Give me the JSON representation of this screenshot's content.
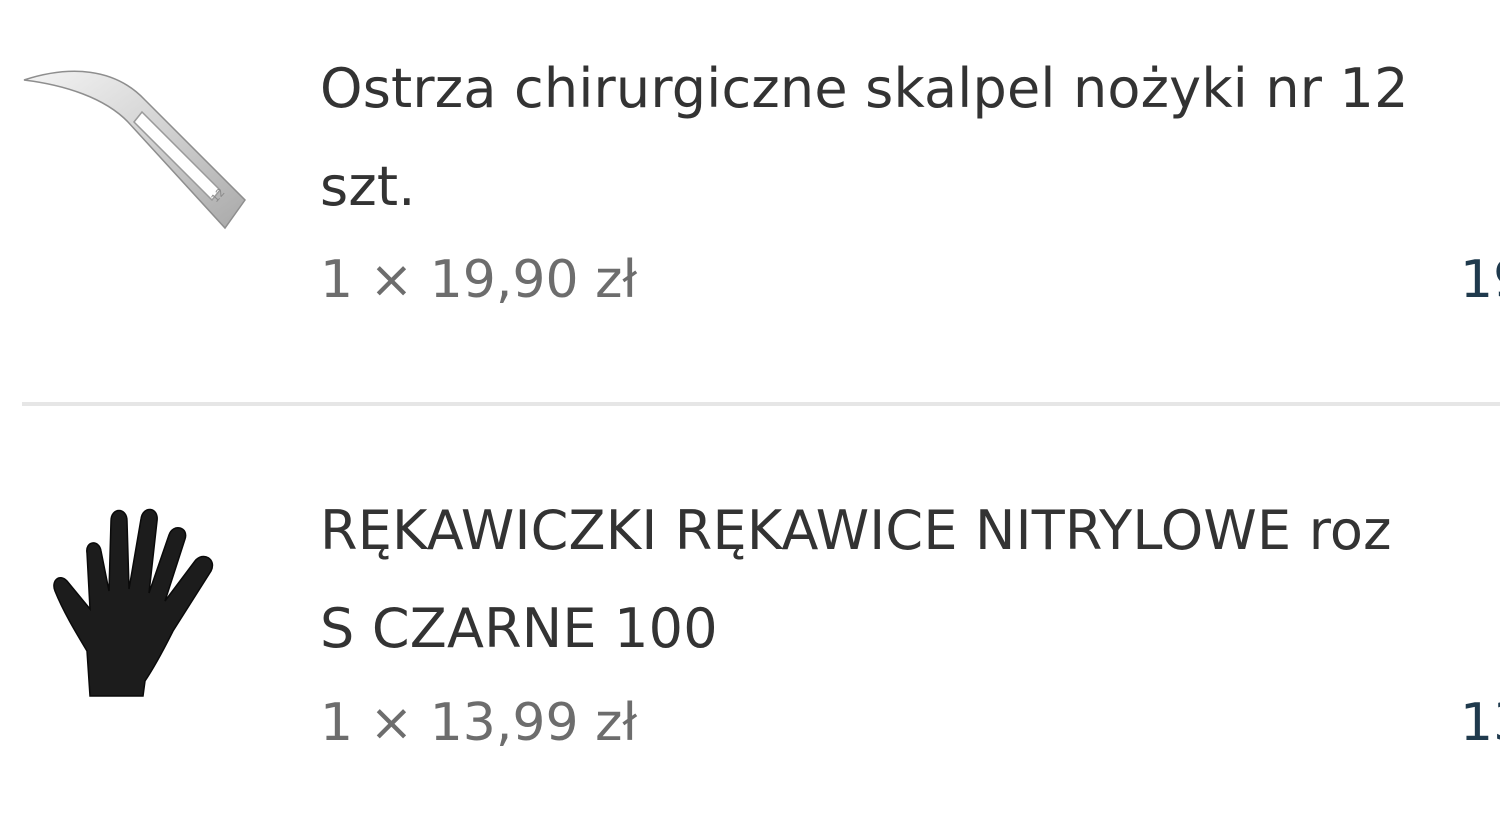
{
  "cart": {
    "items": [
      {
        "title_line1": "Ostrza chirurgiczne skalpel nożyki nr 12",
        "title_line2": "szt.",
        "quantity_price": "1 × 19,90 zł",
        "line_total": "19",
        "image_icon": "scalpel-blade-icon",
        "blade_number": "12"
      },
      {
        "title_line1": "RĘKAWICZKI RĘKAWICE NITRYLOWE roz",
        "title_line2": "S CZARNE 100",
        "quantity_price": "1 × 13,99 zł",
        "line_total": "13",
        "image_icon": "black-glove-icon"
      }
    ],
    "bottom_link": "",
    "accent_color": "#0e8a7a",
    "divider_color": "#e6e6e6"
  }
}
